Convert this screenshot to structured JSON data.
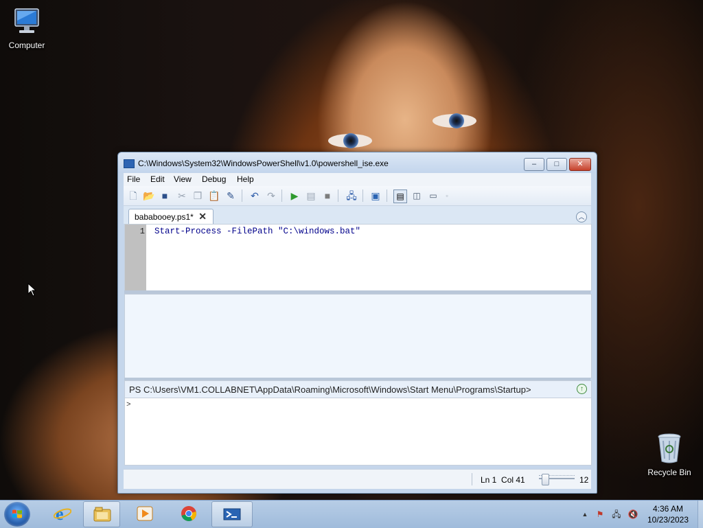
{
  "desktop": {
    "icons": [
      {
        "label": "Computer",
        "icon": "computer-icon"
      },
      {
        "label": "Recycle Bin",
        "icon": "recycle-bin-icon"
      }
    ]
  },
  "window": {
    "title": "C:\\Windows\\System32\\WindowsPowerShell\\v1.0\\powershell_ise.exe",
    "menu": [
      "File",
      "Edit",
      "View",
      "Debug",
      "Help"
    ],
    "caption_buttons": {
      "minimize": "–",
      "maximize": "□",
      "close": "✕"
    },
    "toolbar_icons": [
      "new-icon",
      "open-icon",
      "save-icon",
      "cut-icon",
      "copy-icon",
      "paste-icon",
      "clear-icon",
      "undo-icon",
      "redo-icon",
      "run-icon",
      "run-selection-icon",
      "stop-icon",
      "remote-tab-icon",
      "powershell-console-icon",
      "layout-top-icon",
      "layout-right-icon",
      "layout-max-icon",
      "zoom-icon"
    ]
  },
  "script_tab": {
    "label": "bababooey.ps1*",
    "close": "✕"
  },
  "editor": {
    "line_number": "1",
    "code": "Start-Process -FilePath \"C:\\windows.bat\""
  },
  "prompt": {
    "path": "PS C:\\Users\\VM1.COLLABNET\\AppData\\Roaming\\Microsoft\\Windows\\Start Menu\\Programs\\Startup>",
    "command_prompt": ">"
  },
  "status": {
    "position": "Ln 1  Col 41",
    "zoom_value": "12"
  },
  "taskbar": {
    "apps": [
      {
        "name": "internet-explorer",
        "active": false
      },
      {
        "name": "file-explorer",
        "active": true
      },
      {
        "name": "media-player",
        "active": false
      },
      {
        "name": "chrome",
        "active": false
      },
      {
        "name": "powershell-ise",
        "active": true
      }
    ],
    "time": "4:36 AM",
    "date": "10/23/2023"
  },
  "colors": {
    "code_text": "#00008b",
    "titlebar": "#c3d5ec",
    "taskbar": "#b7cde6"
  }
}
